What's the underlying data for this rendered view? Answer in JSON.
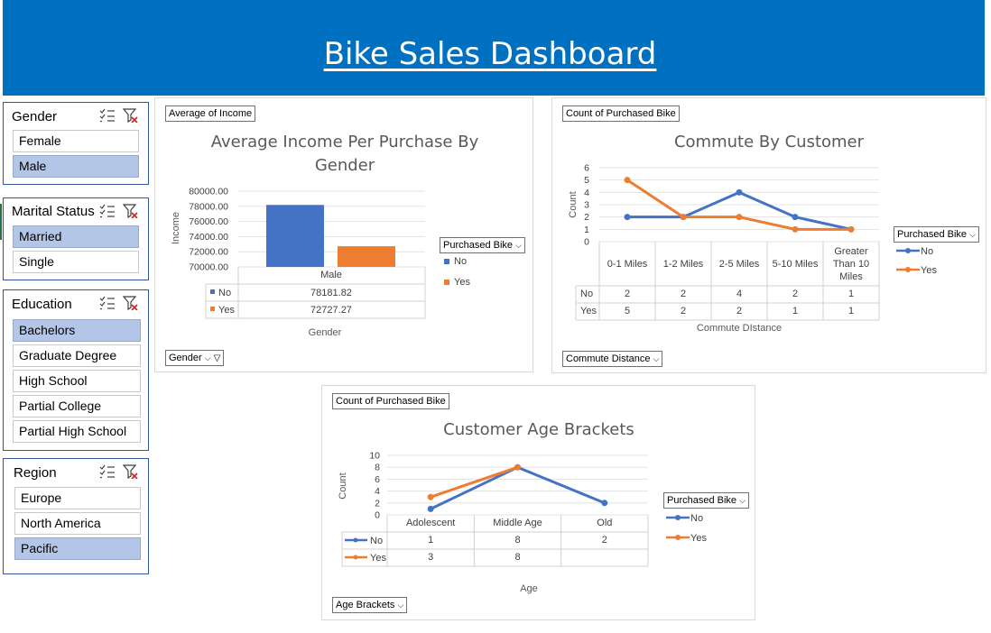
{
  "dashboard": {
    "title": "Bike Sales Dashboard"
  },
  "slicers": {
    "gender": {
      "title": "Gender",
      "items": [
        {
          "label": "Female",
          "selected": false
        },
        {
          "label": "Male",
          "selected": true
        }
      ]
    },
    "marital": {
      "title": "Marital Status",
      "items": [
        {
          "label": "Married",
          "selected": true
        },
        {
          "label": "Single",
          "selected": false
        }
      ]
    },
    "education": {
      "title": "Education",
      "items": [
        {
          "label": "Bachelors",
          "selected": true
        },
        {
          "label": "Graduate Degree",
          "selected": false
        },
        {
          "label": "High School",
          "selected": false
        },
        {
          "label": "Partial College",
          "selected": false
        },
        {
          "label": "Partial High School",
          "selected": false
        }
      ]
    },
    "region": {
      "title": "Region",
      "items": [
        {
          "label": "Europe",
          "selected": false
        },
        {
          "label": "North America",
          "selected": false
        },
        {
          "label": "Pacific",
          "selected": true
        }
      ]
    }
  },
  "icons": {
    "multi_select": "multi-select-icon",
    "clear_filter": "clear-filter-icon",
    "dropdown": "chevron-down-icon",
    "filter": "filter-icon"
  },
  "colors": {
    "banner": "#0070c0",
    "no_series": "#4472c4",
    "yes_series": "#ed7d31",
    "selected_item": "#b4c6e7"
  },
  "chart_data": [
    {
      "id": "income",
      "type": "bar",
      "value_button": "Average of Income",
      "axis_button": "Gender",
      "legend_button": "Purchased Bike",
      "title": "Average Income Per Purchase By Gender",
      "xlabel": "Gender",
      "ylabel": "Income",
      "ylim": [
        70000,
        80000
      ],
      "yticks": [
        "80000.00",
        "78000.00",
        "76000.00",
        "74000.00",
        "72000.00",
        "70000.00"
      ],
      "categories": [
        "Male"
      ],
      "series": [
        {
          "name": "No",
          "values": [
            78181.82
          ],
          "labels": [
            "78181.82"
          ]
        },
        {
          "name": "Yes",
          "values": [
            72727.27
          ],
          "labels": [
            "72727.27"
          ]
        }
      ],
      "legend_position": "right",
      "grid": true
    },
    {
      "id": "commute",
      "type": "line",
      "value_button": "Count of Purchased Bike",
      "axis_button": "Commute Distance",
      "legend_button": "Purchased Bike",
      "title": "Commute By Customer",
      "xlabel": "Commute DIstance",
      "ylabel": "Count",
      "ylim": [
        0,
        6
      ],
      "yticks": [
        "6",
        "5",
        "4",
        "3",
        "2",
        "1",
        "0"
      ],
      "categories": [
        "0-1 Miles",
        "1-2 Miles",
        "2-5 Miles",
        "5-10 Miles",
        "Greater Than 10 Miles"
      ],
      "series": [
        {
          "name": "No",
          "values": [
            2,
            2,
            4,
            2,
            1
          ],
          "labels": [
            "2",
            "2",
            "4",
            "2",
            "1"
          ]
        },
        {
          "name": "Yes",
          "values": [
            5,
            2,
            2,
            1,
            1
          ],
          "labels": [
            "5",
            "2",
            "2",
            "1",
            "1"
          ]
        }
      ],
      "legend_position": "right",
      "grid": true
    },
    {
      "id": "age",
      "type": "line",
      "value_button": "Count of Purchased Bike",
      "axis_button": "Age Brackets",
      "legend_button": "Purchased Bike",
      "title": "Customer Age Brackets",
      "xlabel": "Age",
      "ylabel": "Count",
      "ylim": [
        0,
        10
      ],
      "yticks": [
        "10",
        "8",
        "6",
        "4",
        "2",
        "0"
      ],
      "categories": [
        "Adolescent",
        "Middle Age",
        "Old"
      ],
      "series": [
        {
          "name": "No",
          "values": [
            1,
            8,
            2
          ],
          "labels": [
            "1",
            "8",
            "2"
          ]
        },
        {
          "name": "Yes",
          "values": [
            3,
            8,
            null
          ],
          "labels": [
            "3",
            "8",
            ""
          ]
        }
      ],
      "legend_position": "right",
      "grid": true
    }
  ]
}
